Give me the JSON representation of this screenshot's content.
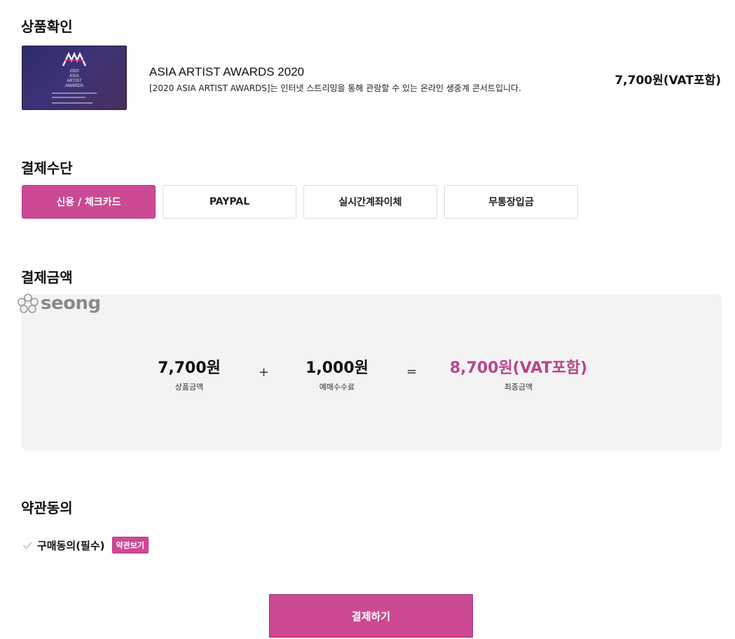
{
  "product_section": {
    "title": "상품확인",
    "item": {
      "name": "ASIA ARTIST AWARDS 2020",
      "description": "[2020 ASIA ARTIST AWARDS]는 인터넷 스트리밍을 통해 관람할 수 있는 온라인 생중계 콘서트입니다.",
      "price": "7,700원(VAT포함)",
      "thumbnail": {
        "year": "2020",
        "line1": "ASIA",
        "line2": "ARTIST",
        "line3": "AWARDS"
      }
    }
  },
  "payment_method_section": {
    "title": "결제수단",
    "methods": [
      {
        "label": "신용 / 체크카드",
        "selected": true
      },
      {
        "label": "PAYPAL",
        "selected": false
      },
      {
        "label": "실시간계좌이체",
        "selected": false
      },
      {
        "label": "무통장입금",
        "selected": false
      }
    ]
  },
  "amount_section": {
    "title": "결제금액",
    "watermark": "seong",
    "product_amount": {
      "value": "7,700원",
      "label": "상품금액"
    },
    "plus": "+",
    "fee": {
      "value": "1,000원",
      "label": "예매수수료"
    },
    "equals": "=",
    "total": {
      "value": "8,700원(VAT포함)",
      "label": "최종금액"
    }
  },
  "terms_section": {
    "title": "약관동의",
    "agree_label": "구매동의(필수)",
    "view_terms_button": "약관보기",
    "checked": false
  },
  "submit_button": "결제하기",
  "colors": {
    "accent": "#cc4994",
    "total_text": "#b8468a",
    "summary_bg": "#f3f3f3"
  },
  "icons": {
    "checkbox": "check-icon",
    "watermark_logo": "flower-logo-icon"
  }
}
